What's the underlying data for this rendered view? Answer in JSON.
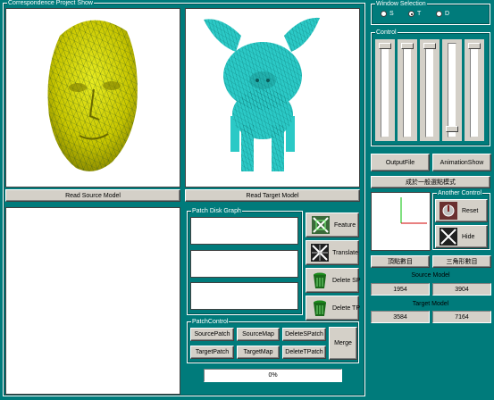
{
  "groups": {
    "correspondence": "Correspondence Project Show",
    "window_selection": "Window Selection",
    "control": "Control",
    "patch_disk_graph": "Patch Disk Graph",
    "another_control": "Another Control",
    "patch_control": "PatchControl"
  },
  "radios": [
    {
      "label": "S",
      "selected": false
    },
    {
      "label": "T",
      "selected": true
    },
    {
      "label": "D",
      "selected": false
    }
  ],
  "sliders": [
    {
      "value": 0.0
    },
    {
      "value": 0.0
    },
    {
      "value": 0.0
    },
    {
      "value": 0.95
    },
    {
      "value": 0.0
    }
  ],
  "buttons": {
    "read_source": "Read Source Model",
    "read_target": "Read Target Model",
    "output_file": "OutputFile",
    "animation_show": "AnimationShow",
    "mode": "成於一般選點模式",
    "reset": "Reset",
    "hide": "Hide",
    "vertex_count": "頂點數目",
    "triangle_count": "三角形數目",
    "feature": "Feature",
    "translate": "Translate",
    "delete_sp": "Delete SP",
    "delete_tp": "Delete TP",
    "source_patch": "SourcePatch",
    "source_map": "SourceMap",
    "delete_s_patch": "DeleteSPatch",
    "target_patch": "TargetPatch",
    "target_map": "TargetMap",
    "delete_t_patch": "DeleteTPatch",
    "merge": "Merge"
  },
  "stats": {
    "source_label": "Source Model",
    "source_vertices": "1954",
    "source_triangles": "3904",
    "target_label": "Target Model",
    "target_vertices": "3584",
    "target_triangles": "7164"
  },
  "progress": {
    "value": 0.0,
    "label": "0%"
  },
  "colors": {
    "background": "#007b7b",
    "face_mesh": "#d4d800",
    "pig_mesh": "#2bc9c6"
  },
  "icons": {
    "feature": "feature-icon",
    "translate": "translate-icon",
    "delete_sp": "trash-icon",
    "delete_tp": "trash-icon",
    "reset": "reset-icon",
    "hide": "hide-icon"
  }
}
